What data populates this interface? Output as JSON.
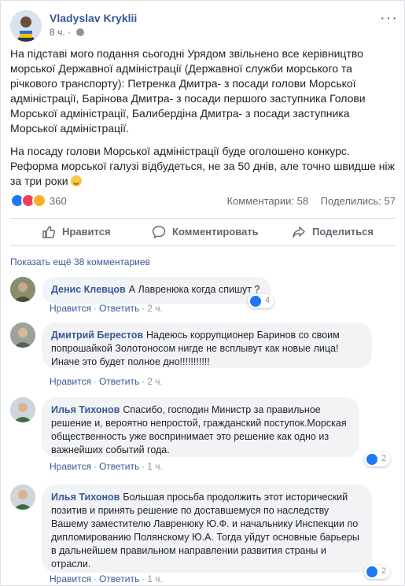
{
  "post": {
    "author": "Vladyslav Kryklii",
    "time": "8 ч.",
    "paragraphs": [
      "На підставі мого подання сьогодні Урядом звільнено все керівництво морської Державної адміністрації (Державної служби морського та річкового транспорту): Петренка Дмитра- з посади голови Морської адміністрації, Барінова Дмитра- з посади першого заступника Голови Морської адміністрації, Балибердіна Дмитра- з посади заступника Морської адміністрації.",
      "На посаду голови Морської адміністрації буде оголошено конкурс. Реформа морської галузі відбудеться, не за 50 днів, але точно швидше ніж за три роки"
    ],
    "reactions_count": "360",
    "comments_count": "Комментарии: 58",
    "shares_count": "Поделились: 57",
    "icons": {
      "menu": "more-options-icon",
      "privacy": "globe-icon",
      "like": "like-reaction-icon",
      "love": "love-reaction-icon",
      "wow": "wow-reaction-icon",
      "emoji": "smiling-face-emoji"
    },
    "colors": {
      "link": "#385898",
      "like": "#2078f4",
      "love": "#f33e58",
      "wow": "#f7b125"
    }
  },
  "actions": {
    "like": "Нравится",
    "comment": "Комментировать",
    "share": "Поделиться"
  },
  "more_comments": "Показать ещё 38 комментариев",
  "comment_actions": {
    "like": "Нравится",
    "reply": "Ответить"
  },
  "comments": [
    {
      "name": "Денис Клевцов",
      "text": "А Лавренюка когда спишут ?",
      "time": "2 ч.",
      "likes": "4"
    },
    {
      "name": "Дмитрий Берестов",
      "text": "Надеюсь коррупционер Баринов со своим попрошайкой Золотоносом нигде не всплывут как новые лица! Иначе это будет полное дно!!!!!!!!!!!",
      "time": "2 ч.",
      "likes": ""
    },
    {
      "name": "Илья Тихонов",
      "text": "Спасибо, господин Министр за правильное решение и, вероятно непростой, гражданский поступок.Морская общественность уже воспринимает это решение как одно из важнейших событий года.",
      "time": "1 ч.",
      "likes": "2"
    },
    {
      "name": "Илья Тихонов",
      "text": "Большая просьба продолжить этот исторический позитив и принять решение по доставшемуся по наследству Вашему заместителю Лавренюку Ю.Ф. и начальнику Инспекции по дипломированию Полянскому Ю.А. Тогда уйдут основные барьеры в дальнейшем правильном направлении развития страны и отрасли.",
      "time": "1 ч.",
      "likes": "2"
    }
  ]
}
